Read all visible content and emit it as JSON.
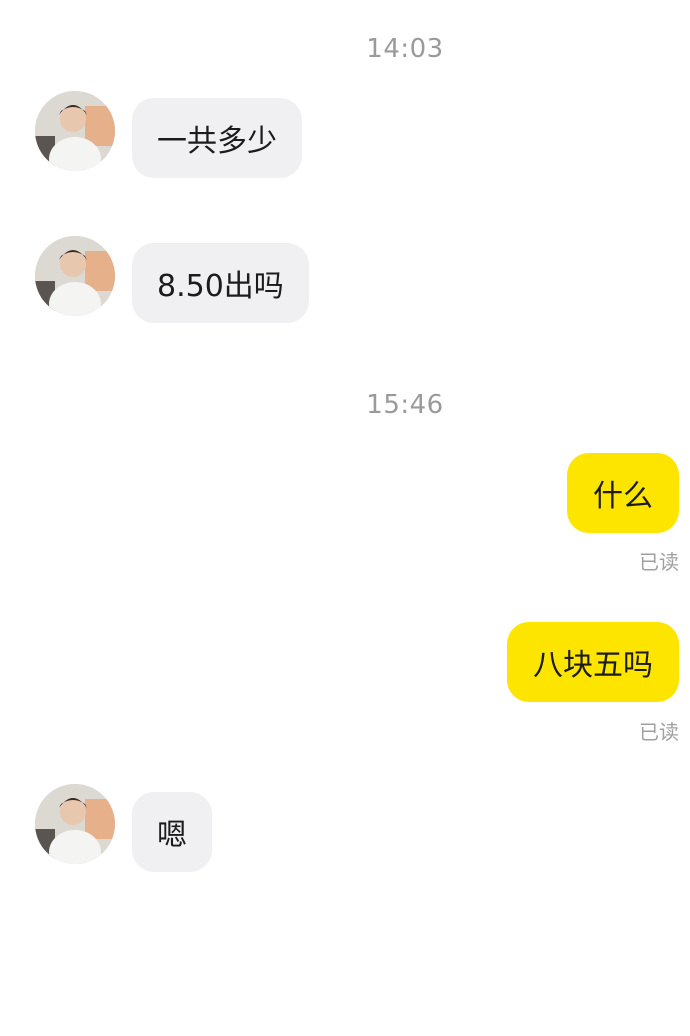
{
  "chat": {
    "timestamps": [
      "14:03",
      "15:46"
    ],
    "messages": [
      {
        "side": "incoming",
        "text": "一共多少"
      },
      {
        "side": "incoming",
        "text": "8.50出吗"
      },
      {
        "side": "outgoing",
        "text": "什么",
        "status": "已读"
      },
      {
        "side": "outgoing",
        "text": "八块五吗",
        "status": "已读"
      },
      {
        "side": "incoming",
        "text": "嗯"
      }
    ]
  },
  "colors": {
    "outgoing_bubble": "#fee500",
    "incoming_bubble": "#f0f0f2",
    "timestamp_text": "#9a9a9a"
  },
  "icons": {
    "avatar": "profile-photo-avatar"
  }
}
